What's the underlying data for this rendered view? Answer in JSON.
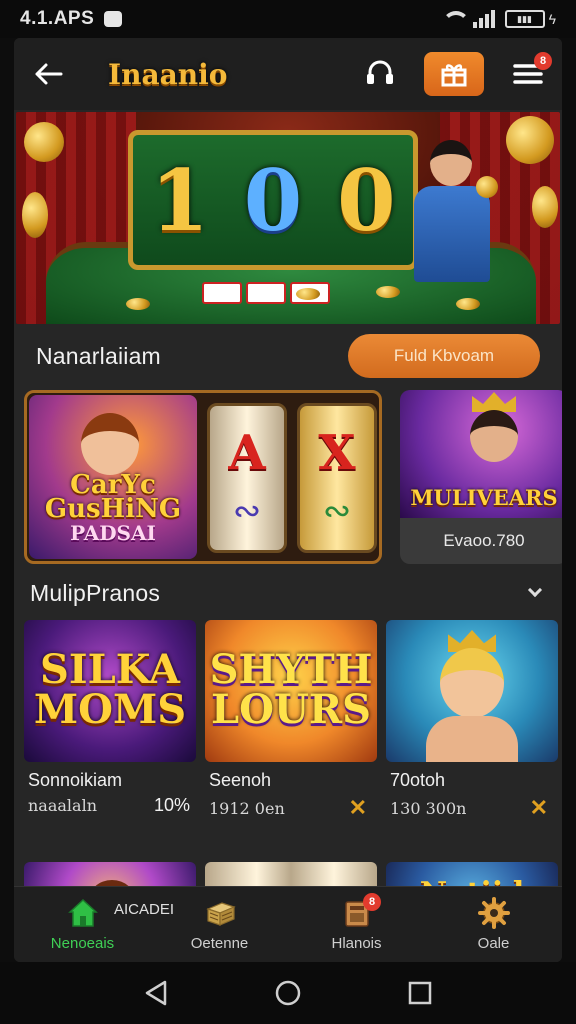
{
  "status": {
    "time": "4.1.APS"
  },
  "header": {
    "title": "Inaanio",
    "notification_count": "8"
  },
  "hero": {
    "digits": [
      "1",
      "0",
      "0"
    ]
  },
  "section1": {
    "title": "Nanarlaiiam",
    "button_label": "Fuld Kbvoam"
  },
  "featured": {
    "big": {
      "logo_line1": "CarYc GusHiNG",
      "logo_line2": "PADSAI",
      "reel_letters": [
        "A",
        "X"
      ]
    },
    "small": {
      "logo": "MULIVEARS",
      "caption": "Evaoo.780"
    }
  },
  "section2": {
    "title": "MulipPranos"
  },
  "games": [
    {
      "logo": "SILKA MOMS",
      "name": "Sonnoikiam",
      "meta": "naaalaln",
      "percent": "10%"
    },
    {
      "logo": "SHYTH LOURS",
      "name": "Seenoh",
      "meta": "1912 0en"
    },
    {
      "logo": "",
      "name": "70otoh",
      "meta": "130 300n"
    }
  ],
  "row2": {
    "logo": "Natiid"
  },
  "nav": {
    "side_label": "AICADEI",
    "items": [
      {
        "label": "Nenoeais",
        "icon": "home-icon",
        "active": true
      },
      {
        "label": "Oetenne",
        "icon": "cash-stack-icon"
      },
      {
        "label": "Hlanois",
        "icon": "inbox-icon",
        "badge": "8"
      },
      {
        "label": "Oale",
        "icon": "gear-icon"
      }
    ]
  },
  "colors": {
    "accent": "#e07a26",
    "gold": "#f4b93a",
    "active_green": "#3fcf55",
    "badge_red": "#e23b2e"
  }
}
